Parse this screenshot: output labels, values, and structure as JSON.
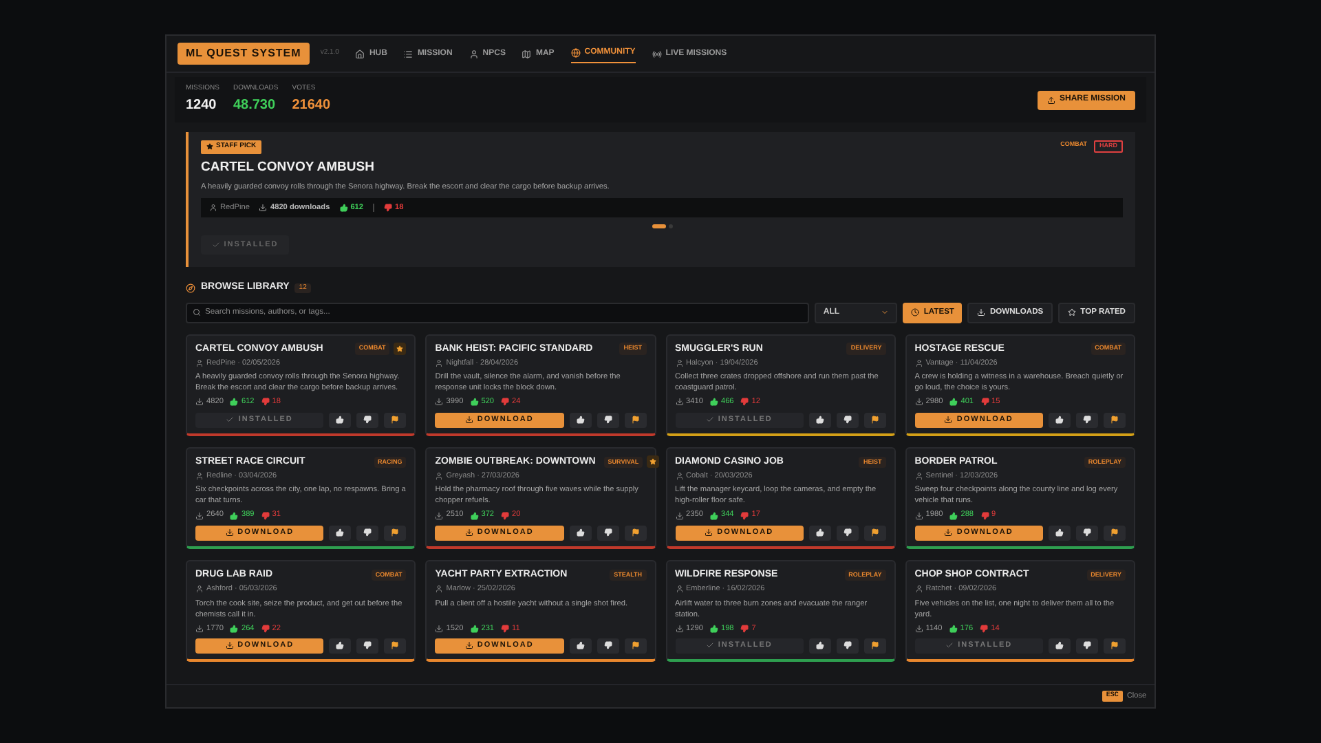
{
  "app": {
    "title": "ML QUEST SYSTEM",
    "version": "v2.1.0"
  },
  "nav": [
    {
      "label": "HUB",
      "selected": false
    },
    {
      "label": "MISSION",
      "selected": false
    },
    {
      "label": "NPCS",
      "selected": false
    },
    {
      "label": "MAP",
      "selected": false
    },
    {
      "label": "COMMUNITY",
      "selected": true
    },
    {
      "label": "LIVE MISSIONS",
      "selected": false
    }
  ],
  "stats": [
    {
      "label": "MISSIONS",
      "value": "1240",
      "color": "#f2f2f2"
    },
    {
      "label": "DOWNLOADS",
      "value": "48.730",
      "color": "#3fcf5a"
    },
    {
      "label": "VOTES",
      "value": "21640",
      "color": "#f0913a"
    }
  ],
  "share_button": "SHARE MISSION",
  "featured": {
    "badge": "STAFF PICK",
    "title": "CARTEL CONVOY AMBUSH",
    "category": "COMBAT",
    "difficulty": "HARD",
    "description": "A heavily guarded convoy rolls through the Senora highway. Break the escort and clear the cargo before backup arrives.",
    "author": "RedPine",
    "downloads": "4820 downloads",
    "likes": "612",
    "dislikes": "18",
    "pages": [
      {
        "selected": true
      },
      {
        "selected": false
      }
    ],
    "action": "INSTALLED"
  },
  "browse": {
    "title": "BROWSE LIBRARY",
    "count": "12",
    "search_placeholder": "Search missions, authors, or tags...",
    "filter": "ALL",
    "sorts": [
      {
        "label": "LATEST",
        "selected": true
      },
      {
        "label": "DOWNLOADS",
        "selected": false
      },
      {
        "label": "TOP RATED",
        "selected": false
      }
    ]
  },
  "cards": [
    {
      "title": "CARTEL CONVOY AMBUSH",
      "category": "COMBAT",
      "featured": true,
      "byline": "RedPine · 02/05/2026",
      "description": "A heavily guarded convoy rolls through the Senora highway. Break the escort and clear the cargo before backup arrives.",
      "downloads": "4820",
      "likes": "612",
      "dislikes": "18",
      "installed": true,
      "action": "INSTALLED",
      "color": "#c0392b"
    },
    {
      "title": "BANK HEIST: PACIFIC STANDARD",
      "category": "HEIST",
      "featured": false,
      "byline": "Nightfall · 28/04/2026",
      "description": "Drill the vault, silence the alarm, and vanish before the response unit locks the block down.",
      "downloads": "3990",
      "likes": "520",
      "dislikes": "24",
      "installed": false,
      "action": "DOWNLOAD",
      "color": "#c0392b"
    },
    {
      "title": "SMUGGLER'S RUN",
      "category": "DELIVERY",
      "featured": false,
      "byline": "Halcyon · 19/04/2026",
      "description": "Collect three crates dropped offshore and run them past the coastguard patrol.",
      "downloads": "3410",
      "likes": "466",
      "dislikes": "12",
      "installed": true,
      "action": "INSTALLED",
      "color": "#d4a017"
    },
    {
      "title": "HOSTAGE RESCUE",
      "category": "COMBAT",
      "featured": false,
      "byline": "Vantage · 11/04/2026",
      "description": "A crew is holding a witness in a warehouse. Breach quietly or go loud, the choice is yours.",
      "downloads": "2980",
      "likes": "401",
      "dislikes": "15",
      "installed": false,
      "action": "DOWNLOAD",
      "color": "#d4a017"
    },
    {
      "title": "STREET RACE CIRCUIT",
      "category": "RACING",
      "featured": false,
      "byline": "Redline · 03/04/2026",
      "description": "Six checkpoints across the city, one lap, no respawns. Bring a car that turns.",
      "downloads": "2640",
      "likes": "389",
      "dislikes": "31",
      "installed": false,
      "action": "DOWNLOAD",
      "color": "#2e9e4f"
    },
    {
      "title": "ZOMBIE OUTBREAK: DOWNTOWN",
      "category": "SURVIVAL",
      "featured": true,
      "byline": "Greyash · 27/03/2026",
      "description": "Hold the pharmacy roof through five waves while the supply chopper refuels.",
      "downloads": "2510",
      "likes": "372",
      "dislikes": "20",
      "installed": false,
      "action": "DOWNLOAD",
      "color": "#c0392b"
    },
    {
      "title": "DIAMOND CASINO JOB",
      "category": "HEIST",
      "featured": false,
      "byline": "Cobalt · 20/03/2026",
      "description": "Lift the manager keycard, loop the cameras, and empty the high-roller floor safe.",
      "downloads": "2350",
      "likes": "344",
      "dislikes": "17",
      "installed": false,
      "action": "DOWNLOAD",
      "color": "#c0392b"
    },
    {
      "title": "BORDER PATROL",
      "category": "ROLEPLAY",
      "featured": false,
      "byline": "Sentinel · 12/03/2026",
      "description": "Sweep four checkpoints along the county line and log every vehicle that runs.",
      "downloads": "1980",
      "likes": "288",
      "dislikes": "9",
      "installed": false,
      "action": "DOWNLOAD",
      "color": "#2e9e4f"
    },
    {
      "title": "DRUG LAB RAID",
      "category": "COMBAT",
      "featured": false,
      "byline": "Ashford · 05/03/2026",
      "description": "Torch the cook site, seize the product, and get out before the chemists call it in.",
      "downloads": "1770",
      "likes": "264",
      "dislikes": "22",
      "installed": false,
      "action": "DOWNLOAD",
      "color": "#e8872e"
    },
    {
      "title": "YACHT PARTY EXTRACTION",
      "category": "STEALTH",
      "featured": false,
      "byline": "Marlow · 25/02/2026",
      "description": "Pull a client off a hostile yacht without a single shot fired.",
      "downloads": "1520",
      "likes": "231",
      "dislikes": "11",
      "installed": false,
      "action": "DOWNLOAD",
      "color": "#e8872e"
    },
    {
      "title": "WILDFIRE RESPONSE",
      "category": "ROLEPLAY",
      "featured": false,
      "byline": "Emberline · 16/02/2026",
      "description": "Airlift water to three burn zones and evacuate the ranger station.",
      "downloads": "1290",
      "likes": "198",
      "dislikes": "7",
      "installed": true,
      "action": "INSTALLED",
      "color": "#2e9e4f"
    },
    {
      "title": "CHOP SHOP CONTRACT",
      "category": "DELIVERY",
      "featured": false,
      "byline": "Ratchet · 09/02/2026",
      "description": "Five vehicles on the list, one night to deliver them all to the yard.",
      "downloads": "1140",
      "likes": "176",
      "dislikes": "14",
      "installed": true,
      "action": "INSTALLED",
      "color": "#e8872e"
    }
  ],
  "footer": {
    "key": "ESC",
    "label": "Close"
  }
}
